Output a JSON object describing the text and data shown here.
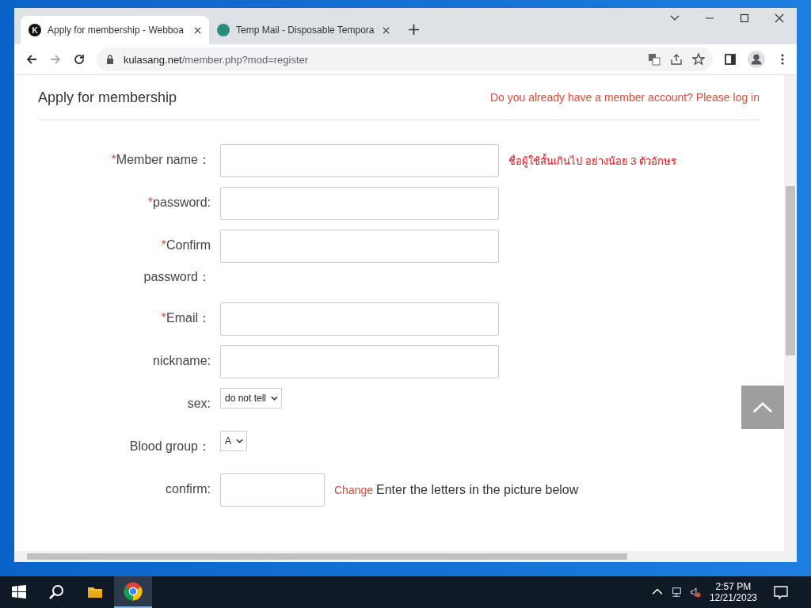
{
  "tabs": [
    {
      "title": "Apply for membership - Webboa",
      "icon": "K",
      "selected": true
    },
    {
      "title": "Temp Mail - Disposable Tempora",
      "selected": false
    }
  ],
  "address": {
    "domain": "kulasang.net",
    "path": "/member.php?mod=register"
  },
  "page": {
    "title": "Apply for membership",
    "login_link": "Do you already have a member account? Please log in",
    "fields": [
      {
        "kind": "text",
        "marker": "*",
        "label": "Member name：",
        "error": "ชื่อผู้ใช้สั้นเกินไป อย่างน้อย 3 ตัวอักษร"
      },
      {
        "kind": "text",
        "marker": "*",
        "label": "password:"
      },
      {
        "kind": "text",
        "marker": "*",
        "label": "Confirm password："
      },
      {
        "kind": "text",
        "marker": "*",
        "label": "Email："
      },
      {
        "kind": "text",
        "label": "nickname:"
      },
      {
        "kind": "select",
        "label": "sex:",
        "value": "do not tell"
      },
      {
        "kind": "select",
        "label": "Blood group：",
        "value": "A"
      },
      {
        "kind": "captcha",
        "label": "confirm:",
        "link": "Change",
        "hint": "Enter the letters in the picture below"
      }
    ]
  },
  "taskbar": {
    "time": "2:57 PM",
    "date": "12/21/2023"
  }
}
